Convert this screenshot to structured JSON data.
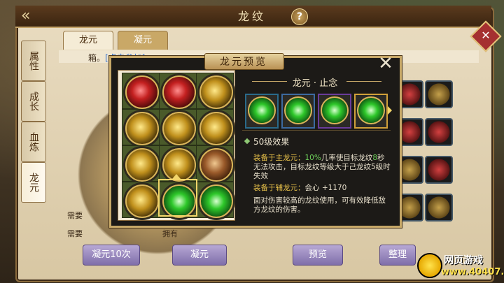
{
  "window": {
    "title": "龙纹",
    "help": "?"
  },
  "tabs": [
    {
      "label": "龙元"
    },
    {
      "label": "凝元"
    }
  ],
  "side_tabs": [
    {
      "label": "属性"
    },
    {
      "label": "成长"
    },
    {
      "label": "血炼"
    },
    {
      "label": "龙元"
    }
  ],
  "strip": {
    "prefix": "箱。",
    "link": "[点击参加]"
  },
  "need_rows": [
    {
      "label": "需要"
    },
    {
      "label": "需要"
    }
  ],
  "owned_label": "拥有",
  "bottom_buttons": [
    {
      "label": "凝元10次"
    },
    {
      "label": "凝元"
    },
    {
      "label": "预览"
    },
    {
      "label": "整理"
    }
  ],
  "popup": {
    "title": "龙元预览",
    "close": "✕",
    "detail_title": "龙元 · 止念",
    "level_effect": "50级效果",
    "main_label": "装备于主龙元：",
    "main_pct": "10%",
    "main_rest1": "几率使目标龙纹",
    "main_sec": "8",
    "main_rest2": "秒无法攻击，目标龙纹等级大于己龙纹5级时失效",
    "aux_label": "装备于辅龙元：",
    "aux_value": "会心 +1170",
    "desc": "面对伤害较高的龙纹使用，可有效降低敌方龙纹的伤害。"
  },
  "gem_grid_colors": [
    "red",
    "red",
    "gold",
    "gold",
    "gold",
    "gold",
    "gold",
    "gold",
    "brown",
    "gold",
    "green",
    "green"
  ],
  "variant_colors": [
    "#2a6a8a",
    "#3c6aa0",
    "#6a3c9a",
    "#d0a03a"
  ],
  "logo": {
    "line1": "网页游戏",
    "line2": "www.40407.com"
  }
}
